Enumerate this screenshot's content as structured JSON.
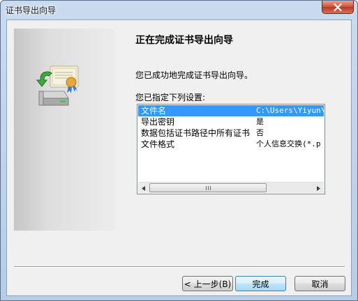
{
  "window": {
    "title": "证书导出向导",
    "close_symbol": "✕"
  },
  "content": {
    "heading": "正在完成证书导出向导",
    "intro": "您已成功地完成证书导出向导。",
    "list_label": "您已指定下列设置:"
  },
  "settings_list": {
    "rows": [
      {
        "key": "文件名",
        "value": "C:\\Users\\Yiyun\\D",
        "selected": true
      },
      {
        "key": "导出密钥",
        "value": "是",
        "selected": false
      },
      {
        "key": "数据包括证书路径中所有证书",
        "value": "否",
        "selected": false
      },
      {
        "key": "文件格式",
        "value": "个人信息交换(*.p",
        "selected": false
      }
    ],
    "scrollbar": {
      "left_arrow": "◂",
      "right_arrow": "▸"
    }
  },
  "buttons": {
    "back": "< 上一步(B)",
    "finish": "完成",
    "cancel": "取消"
  },
  "colors": {
    "selection": "#3399ff",
    "close_button": "#c9503a"
  },
  "icons": {
    "side": "certificate-export-icon",
    "close": "close-icon"
  }
}
